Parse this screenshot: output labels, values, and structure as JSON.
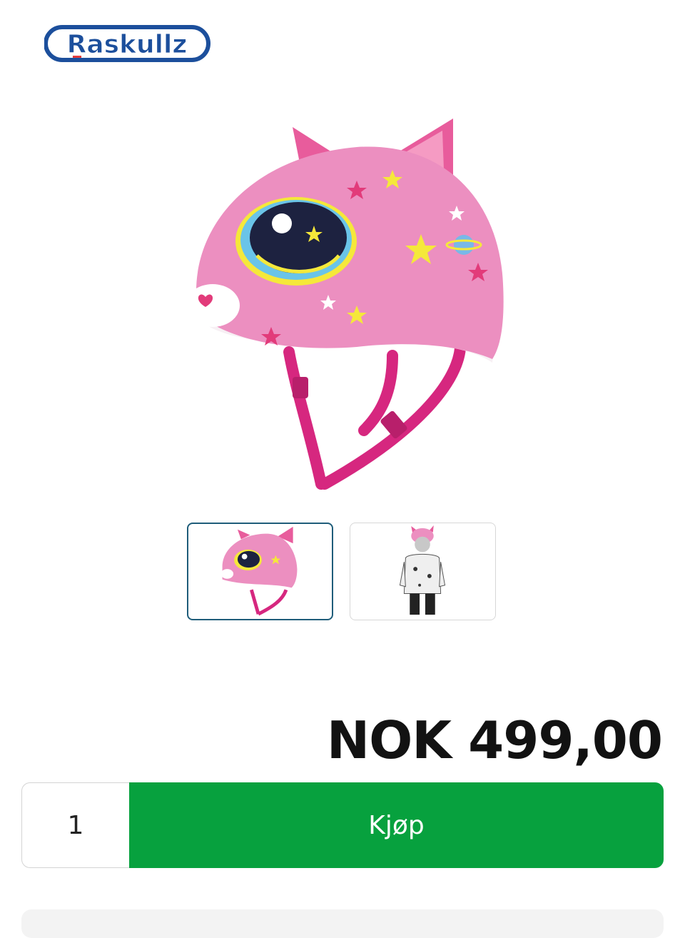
{
  "header": {
    "logo_text": "Raskullz"
  },
  "product": {
    "image_icon": "pink-cat-helmet-image",
    "thumbnails": [
      {
        "icon": "helmet-thumbnail",
        "selected": true
      },
      {
        "icon": "child-wearing-helmet-thumbnail",
        "selected": false
      }
    ],
    "price": "NOK 499,00"
  },
  "purchase": {
    "quantity": "1",
    "buy_label": "Kjøp"
  },
  "colors": {
    "buy_button": "#07a13e",
    "helmet_pink": "#ec8fc0",
    "strap_magenta": "#d6277f",
    "logo_blue": "#1c4f9c",
    "selected_border": "#1f5d7a"
  }
}
